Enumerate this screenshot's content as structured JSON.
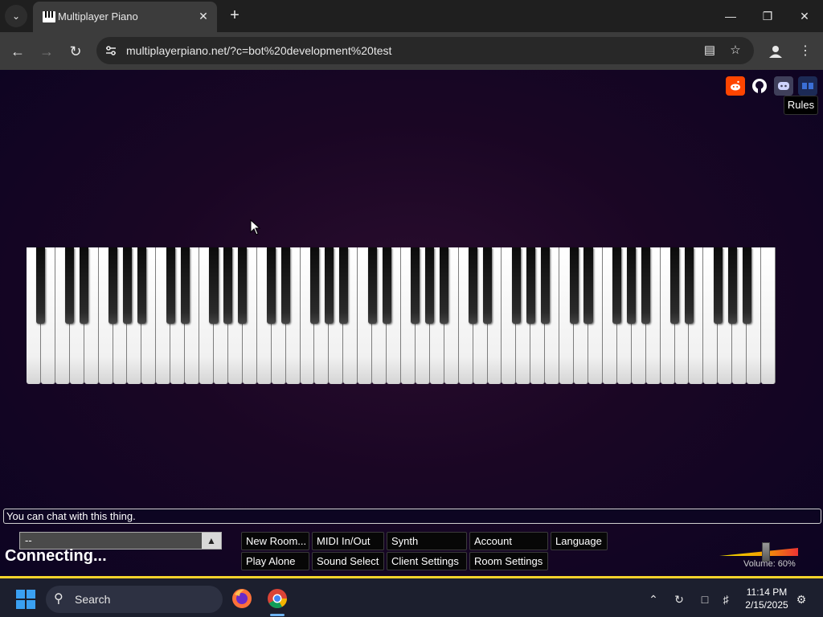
{
  "browser": {
    "tab_title": "Multiplayer Piano",
    "url": "multiplayerpiano.net/?c=bot%20development%20test"
  },
  "icons": {
    "tab_search": "chevron-down-icon",
    "tab_close": "close-icon",
    "new_tab": "plus-icon",
    "back": "arrow-left-icon",
    "forward": "arrow-right-icon",
    "reload": "reload-icon",
    "site_info": "tune-icon",
    "reading_mode": "reading-mode-icon",
    "bookmark": "star-icon",
    "profile": "profile-icon",
    "menu": "kebab-menu-icon"
  },
  "page": {
    "social_links": [
      {
        "name": "reddit-icon",
        "color": "#ff4500"
      },
      {
        "name": "github-icon",
        "color": "#ffffff"
      },
      {
        "name": "discord-icon",
        "color": "#5865f2"
      },
      {
        "name": "extra-icon",
        "color": "#3b6fd6"
      }
    ],
    "rules_label": "Rules",
    "chat_hint": "You can chat with this thing.",
    "room_select_value": "--",
    "status_text": "Connecting...",
    "buttons": {
      "new_room": "New Room...",
      "midi": "MIDI In/Out",
      "synth": "Synth",
      "account": "Account",
      "language": "Language",
      "play_alone": "Play Alone",
      "sound_select": "Sound Select",
      "client_settings": "Client Settings",
      "room_settings": "Room Settings"
    },
    "volume_label": "Volume: 60%",
    "volume_level_percent": 60,
    "piano": {
      "white_keys": 52,
      "black_key_pattern": [
        "A#",
        "C#",
        "D#",
        "F#",
        "G#",
        "A#"
      ]
    }
  },
  "taskbar": {
    "search_placeholder": "Search",
    "time": "11:14 PM",
    "date": "2/15/2025"
  }
}
